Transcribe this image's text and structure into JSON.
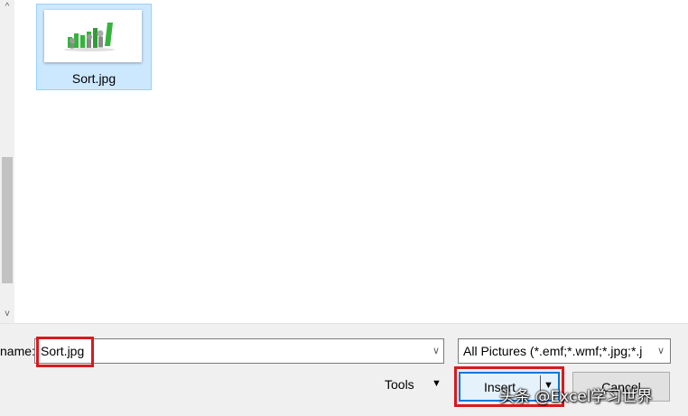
{
  "file_list": {
    "items": [
      {
        "name": "Sort.jpg",
        "selected": true,
        "thumbnail_icon": "bar-chart-figures-thumbnail"
      }
    ]
  },
  "scrollbar": {
    "up_glyph": "^",
    "down_glyph": "v"
  },
  "file_name": {
    "label": "name:",
    "value": "Sort.jpg",
    "chevron": "∨"
  },
  "file_type": {
    "selected": "All Pictures (*.emf;*.wmf;*.jpg;*.j",
    "chevron": "∨"
  },
  "actions": {
    "tools_label": "Tools",
    "tools_caret": "▼",
    "insert_label": "Insert",
    "insert_caret": "▼",
    "cancel_label": "Cancel"
  },
  "watermark": "头条 @Excel学习世界",
  "colors": {
    "selection_bg": "#cce8ff",
    "selection_border": "#99d1ff",
    "highlight_red": "#d9191f",
    "primary_border": "#0078d7",
    "chart_green": "#35b33c"
  }
}
